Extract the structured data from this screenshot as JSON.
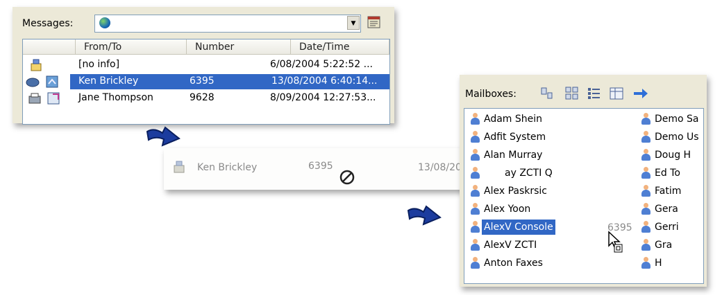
{
  "messages_panel": {
    "label": "Messages:",
    "columns": [
      "From/To",
      "Number",
      "Date/Time"
    ],
    "rows": [
      {
        "name": "[no info]",
        "number": "",
        "datetime": "6/08/2004 5:22:52 ...",
        "selected": false,
        "icon": "phone-envelope-icon"
      },
      {
        "name": "Ken Brickley",
        "number": "6395",
        "datetime": "13/08/2004 6:40:14...",
        "selected": true,
        "icon": "voicemail-icon"
      },
      {
        "name": "Jane Thompson",
        "number": "9628",
        "datetime": "8/09/2004 12:27:53...",
        "selected": false,
        "icon": "fax-icon"
      }
    ]
  },
  "drag_preview": {
    "name": "Ken Brickley",
    "number": "6395",
    "datetime": "13/08/2004 6:40:14...",
    "cursor": "no-drop-cursor"
  },
  "mailboxes_panel": {
    "label": "Mailboxes:",
    "toolbar_icons": [
      "large-icons-icon",
      "small-icons-icon",
      "list-icon",
      "details-icon",
      "arrow-right-icon"
    ],
    "col1": [
      "Adam Shein",
      "Adfit System",
      "Alan Murray",
      "ay ZCTI Q",
      "Alex Paskrsic",
      "Alex Yoon",
      "AlexV Console",
      "AlexV ZCTI",
      "Anton Faxes"
    ],
    "col2": [
      "Demo Sa",
      "Demo Us",
      "Doug H",
      "Ed To",
      "Fatim",
      "Gera",
      "Gerri",
      "Gra",
      "H"
    ],
    "drag_number": "6395",
    "selected_index": 6
  },
  "colors": {
    "selection": "#3167c5",
    "panel": "#ece9d8",
    "arrow": "#1c3c9e"
  }
}
